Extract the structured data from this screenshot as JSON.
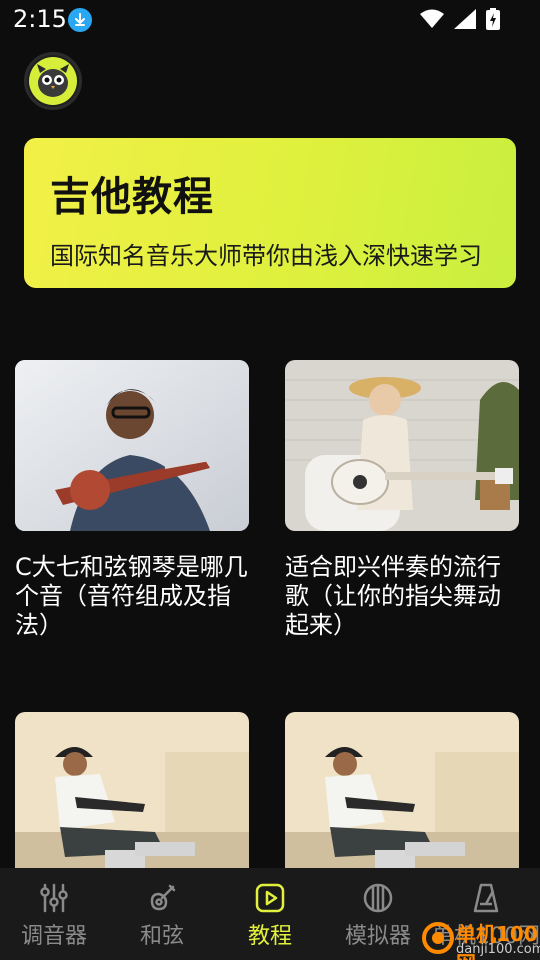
{
  "status_bar": {
    "time": "2:15"
  },
  "banner": {
    "title": "吉他教程",
    "subtitle": "国际知名音乐大师带你由浅入深快速学习"
  },
  "cards": [
    {
      "title": "C大七和弦钢琴是哪几个音（音符组成及指法）"
    },
    {
      "title": "适合即兴伴奏的流行歌（让你的指尖舞动起来）"
    },
    {
      "title": ""
    },
    {
      "title": ""
    }
  ],
  "nav": {
    "items": [
      {
        "label": "调音器",
        "icon": "tuner-sliders-icon",
        "active": false
      },
      {
        "label": "和弦",
        "icon": "guitar-icon",
        "active": false
      },
      {
        "label": "教程",
        "icon": "play-icon",
        "active": true
      },
      {
        "label": "模拟器",
        "icon": "strings-icon",
        "active": false
      },
      {
        "label": "单机100网",
        "icon": "metronome-icon",
        "active": false
      }
    ]
  },
  "watermark": {
    "line1": "单机100网",
    "line2": "danji100.com"
  },
  "colors": {
    "accent": "#e2f13c",
    "background": "#0d0d0d",
    "nav_background": "#1a1a1a",
    "inactive": "#8a8a8a"
  }
}
